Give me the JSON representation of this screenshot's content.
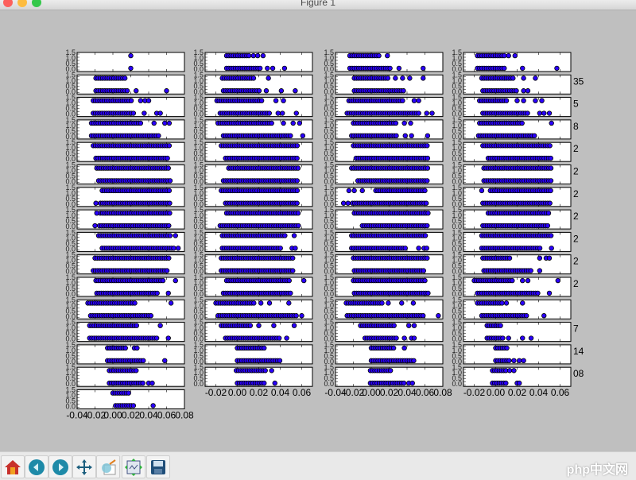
{
  "window": {
    "title": "Figure 1",
    "watermark": "php中文网"
  },
  "toolbar": [
    {
      "name": "home",
      "icon": "home-icon"
    },
    {
      "name": "back",
      "icon": "back-arrow-icon"
    },
    {
      "name": "forward",
      "icon": "forward-arrow-icon"
    },
    {
      "name": "pan",
      "icon": "pan-icon"
    },
    {
      "name": "zoom",
      "icon": "zoom-rect-icon"
    },
    {
      "name": "subplots",
      "icon": "subplots-config-icon"
    },
    {
      "name": "save",
      "icon": "save-icon"
    }
  ],
  "colors": {
    "marker": "#2a00ff",
    "figure_bg": "#bfbfbf"
  },
  "chart_data": {
    "type": "scatter",
    "title": "",
    "yticks": [
      "0.0",
      "0.5",
      "1.0",
      "1.5"
    ],
    "row_y": [
      1,
      0
    ],
    "right_fragments": [
      "",
      "35",
      "5",
      "8",
      "2",
      "2",
      "2",
      "2",
      "2",
      "2",
      "2",
      "",
      "7",
      "14",
      "08"
    ],
    "columns": [
      {
        "xlim": [
          -0.04,
          0.08
        ],
        "xticks": [
          "-0.04",
          "-0.02",
          "0.00",
          "0.02",
          "0.04",
          "0.06",
          "0.08"
        ],
        "xtick_values": [
          -0.04,
          -0.02,
          0,
          0.02,
          0.04,
          0.06,
          0.08
        ],
        "panels": [
          [
            [
              0.02,
              0.02,
              []
            ],
            [
              0.02,
              0.02,
              []
            ]
          ],
          [
            [
              -0.019,
              0.015,
              []
            ],
            [
              -0.019,
              0.018,
              [
                0.026,
                0.06
              ]
            ]
          ],
          [
            [
              -0.022,
              0.021,
              [
                0.031,
                0.036,
                0.04
              ]
            ],
            [
              -0.022,
              0.025,
              [
                0.035,
                0.049,
                0.053
              ]
            ]
          ],
          [
            [
              -0.024,
              0.031,
              [
                0.046,
                0.058,
                0.063
              ]
            ],
            [
              -0.024,
              0.052,
              []
            ]
          ],
          [
            [
              -0.022,
              0.064,
              []
            ],
            [
              -0.019,
              0.062,
              []
            ]
          ],
          [
            [
              -0.018,
              0.064,
              []
            ],
            [
              -0.016,
              0.064,
              []
            ]
          ],
          [
            [
              -0.012,
              0.064,
              []
            ],
            [
              -0.014,
              0.064,
              [
                -0.019
              ]
            ]
          ],
          [
            [
              -0.014,
              0.064,
              [
                -0.018
              ]
            ],
            [
              -0.015,
              0.064,
              [
                -0.02
              ]
            ]
          ],
          [
            [
              -0.016,
              0.064,
              [
                0.07
              ]
            ],
            [
              -0.012,
              0.068,
              [
                0.073
              ]
            ]
          ],
          [
            [
              -0.02,
              0.064,
              []
            ],
            [
              -0.022,
              0.062,
              []
            ]
          ],
          [
            [
              -0.019,
              0.058,
              [
                0.07
              ]
            ],
            [
              -0.018,
              0.05,
              [
                0.062
              ]
            ]
          ],
          [
            [
              -0.028,
              0.025,
              [
                0.065
              ]
            ],
            [
              -0.025,
              0.043,
              []
            ]
          ],
          [
            [
              -0.026,
              0.028,
              [
                0.053
              ]
            ],
            [
              -0.026,
              0.05,
              [
                0.062
              ]
            ]
          ],
          [
            [
              -0.006,
              0.016,
              [
                0.024,
                0.027
              ]
            ],
            [
              -0.006,
              0.034,
              [
                0.058
              ]
            ]
          ],
          [
            [
              -0.004,
              0.027,
              []
            ],
            [
              -0.004,
              0.035,
              [
                0.04,
                0.044
              ]
            ]
          ],
          [
            [
              0.0,
              0.019,
              []
            ],
            [
              0.003,
              0.025,
              [
                0.045
              ]
            ]
          ]
        ]
      },
      {
        "xlim": [
          -0.03,
          0.07
        ],
        "xticks": [
          "-0.02",
          "0.00",
          "0.02",
          "0.04",
          "0.06"
        ],
        "xtick_values": [
          -0.02,
          0,
          0.02,
          0.04,
          0.06
        ],
        "panels": [
          [
            [
              -0.01,
              0.011,
              [
                0.015,
                0.019,
                0.024
              ]
            ],
            [
              -0.01,
              0.022,
              [
                0.028,
                0.033,
                0.044
              ]
            ]
          ],
          [
            [
              -0.014,
              0.016,
              [
                0.029
              ]
            ],
            [
              -0.013,
              0.021,
              [
                0.027,
                0.041,
                0.054
              ]
            ]
          ],
          [
            [
              -0.019,
              0.023,
              [
                0.036,
                0.043
              ]
            ],
            [
              -0.016,
              0.03,
              [
                0.038,
                0.042,
                0.055
              ]
            ]
          ],
          [
            [
              -0.018,
              0.033,
              [
                0.043,
                0.052,
                0.058
              ]
            ],
            [
              -0.013,
              0.051,
              [
                0.061
              ]
            ]
          ],
          [
            [
              -0.015,
              0.057,
              []
            ],
            [
              -0.011,
              0.057,
              []
            ]
          ],
          [
            [
              -0.008,
              0.057,
              []
            ],
            [
              -0.013,
              0.057,
              []
            ]
          ],
          [
            [
              -0.015,
              0.057,
              []
            ],
            [
              -0.011,
              0.057,
              []
            ]
          ],
          [
            [
              -0.01,
              0.057,
              []
            ],
            [
              -0.016,
              0.057,
              []
            ]
          ],
          [
            [
              -0.014,
              0.045,
              [
                0.053
              ]
            ],
            [
              -0.014,
              0.042,
              [
                0.051,
                0.054
              ]
            ]
          ],
          [
            [
              -0.015,
              0.053,
              []
            ],
            [
              -0.015,
              0.052,
              []
            ]
          ],
          [
            [
              -0.01,
              0.05,
              [
                0.062
              ]
            ],
            [
              -0.013,
              0.051,
              []
            ]
          ],
          [
            [
              -0.02,
              0.017,
              [
                0.022,
                0.03,
                0.048
              ]
            ],
            [
              -0.018,
              0.055,
              [
                0.06
              ]
            ]
          ],
          [
            [
              -0.015,
              0.014,
              [
                0.02,
                0.034,
                0.053
              ]
            ],
            [
              -0.011,
              0.041,
              [
                0.046
              ]
            ]
          ],
          [
            [
              0.0,
              0.027,
              []
            ],
            [
              0.0,
              0.04,
              []
            ]
          ],
          [
            [
              -0.001,
              0.027,
              [
                0.032
              ]
            ],
            [
              0.0,
              0.025,
              [
                0.035
              ]
            ]
          ]
        ]
      },
      {
        "xlim": [
          -0.04,
          0.08
        ],
        "xticks": [
          "-0.04",
          "-0.02",
          "0.00",
          "0.02",
          "0.04",
          "0.06",
          "0.08"
        ],
        "xtick_values": [
          -0.04,
          -0.02,
          0,
          0.02,
          0.04,
          0.06,
          0.08
        ],
        "panels": [
          [
            [
              -0.024,
              0.01,
              [
                0.018
              ]
            ],
            [
              -0.024,
              0.022,
              [
                0.031,
                0.058
              ]
            ]
          ],
          [
            [
              -0.019,
              0.019,
              [
                0.027,
                0.035,
                0.043,
                0.058
              ]
            ],
            [
              -0.019,
              0.037,
              []
            ]
          ],
          [
            [
              -0.025,
              0.035,
              [
                0.048,
                0.053
              ]
            ],
            [
              -0.027,
              0.055,
              [
                0.062,
                0.068
              ]
            ]
          ],
          [
            [
              -0.02,
              0.028,
              [
                0.037,
                0.044
              ]
            ],
            [
              -0.022,
              0.029,
              [
                0.038,
                0.045,
                0.063
              ]
            ]
          ],
          [
            [
              -0.02,
              0.064,
              []
            ],
            [
              -0.017,
              0.064,
              []
            ]
          ],
          [
            [
              -0.022,
              0.064,
              []
            ],
            [
              -0.015,
              0.064,
              []
            ]
          ],
          [
            [
              0.005,
              0.061,
              [
                -0.025,
                -0.019,
                -0.01
              ]
            ],
            [
              -0.021,
              0.062,
              [
                -0.031,
                -0.026
              ]
            ]
          ],
          [
            [
              -0.019,
              0.064,
              []
            ],
            [
              -0.01,
              0.064,
              []
            ]
          ],
          [
            [
              -0.022,
              0.062,
              []
            ],
            [
              -0.022,
              0.038,
              [
                0.053,
                0.059,
                0.062
              ]
            ]
          ],
          [
            [
              -0.02,
              0.064,
              []
            ],
            [
              -0.019,
              0.059,
              []
            ]
          ],
          [
            [
              -0.02,
              0.061,
              []
            ],
            [
              -0.019,
              0.064,
              []
            ]
          ],
          [
            [
              -0.028,
              0.013,
              [
                0.019,
                0.034,
                0.047
              ]
            ],
            [
              -0.027,
              0.058,
              [
                0.075
              ]
            ]
          ],
          [
            [
              -0.012,
              0.026,
              [
                0.042,
                0.048
              ]
            ],
            [
              -0.007,
              0.029,
              [
                0.037,
                0.045,
                0.048
              ]
            ]
          ],
          [
            [
              0.0,
              0.025,
              [
                0.037
              ]
            ],
            [
              0.0,
              0.048,
              []
            ]
          ],
          [
            [
              -0.001,
              0.022,
              []
            ],
            [
              -0.001,
              0.038,
              [
                0.042,
                0.046
              ]
            ]
          ]
        ]
      },
      {
        "xlim": [
          -0.03,
          0.07
        ],
        "xticks": [
          "-0.02",
          "0.00",
          "0.02",
          "0.04",
          "0.06"
        ],
        "xtick_values": [
          -0.02,
          0,
          0.02,
          0.04,
          0.06
        ],
        "panels": [
          [
            [
              -0.017,
              0.008,
              [
                0.012,
                0.018
              ]
            ],
            [
              -0.017,
              0.01,
              [
                0.025,
                0.057
              ]
            ]
          ],
          [
            [
              -0.013,
              0.017,
              [
                0.026,
                0.037
              ]
            ],
            [
              -0.012,
              0.02,
              [
                0.026,
                0.03
              ]
            ]
          ],
          [
            [
              -0.015,
              0.01,
              [
                0.02,
                0.026,
                0.037,
                0.043
              ]
            ],
            [
              -0.012,
              0.03,
              [
                0.041,
                0.045,
                0.05
              ]
            ]
          ],
          [
            [
              -0.015,
              0.025,
              [
                0.052
              ]
            ],
            [
              -0.016,
              0.038,
              []
            ]
          ],
          [
            [
              -0.012,
              0.052,
              []
            ],
            [
              -0.007,
              0.052,
              []
            ]
          ],
          [
            [
              -0.011,
              0.052,
              []
            ],
            [
              -0.011,
              0.052,
              []
            ]
          ],
          [
            [
              -0.005,
              0.052,
              [
                -0.013
              ]
            ],
            [
              -0.012,
              0.052,
              []
            ]
          ],
          [
            [
              -0.007,
              0.05,
              []
            ],
            [
              -0.012,
              0.05,
              []
            ]
          ],
          [
            [
              -0.013,
              0.052,
              []
            ],
            [
              -0.013,
              0.042,
              [
                0.052
              ]
            ]
          ],
          [
            [
              -0.012,
              0.013,
              [
                0.041,
                0.047,
                0.05
              ]
            ],
            [
              -0.011,
              0.033,
              [
                0.041
              ]
            ]
          ],
          [
            [
              -0.02,
              0.017,
              [
                0.025,
                0.03,
                0.058
              ]
            ],
            [
              -0.017,
              0.04,
              [
                0.05
              ]
            ]
          ],
          [
            [
              -0.017,
              0.006,
              [
                0.01,
                0.025
              ]
            ],
            [
              -0.013,
              0.03,
              [
                0.045
              ]
            ]
          ],
          [
            [
              -0.008,
              0.005,
              []
            ],
            [
              -0.008,
              0.008,
              [
                0.012,
                0.025,
                0.033
              ]
            ]
          ],
          [
            [
              0.0,
              0.012,
              []
            ],
            [
              0.0,
              0.014,
              [
                0.017,
                0.022,
                0.026
              ]
            ]
          ],
          [
            [
              -0.003,
              0.01,
              [
                0.013,
                0.017
              ]
            ],
            [
              -0.003,
              0.01,
              [
                0.02,
                0.022
              ]
            ]
          ]
        ]
      }
    ]
  }
}
